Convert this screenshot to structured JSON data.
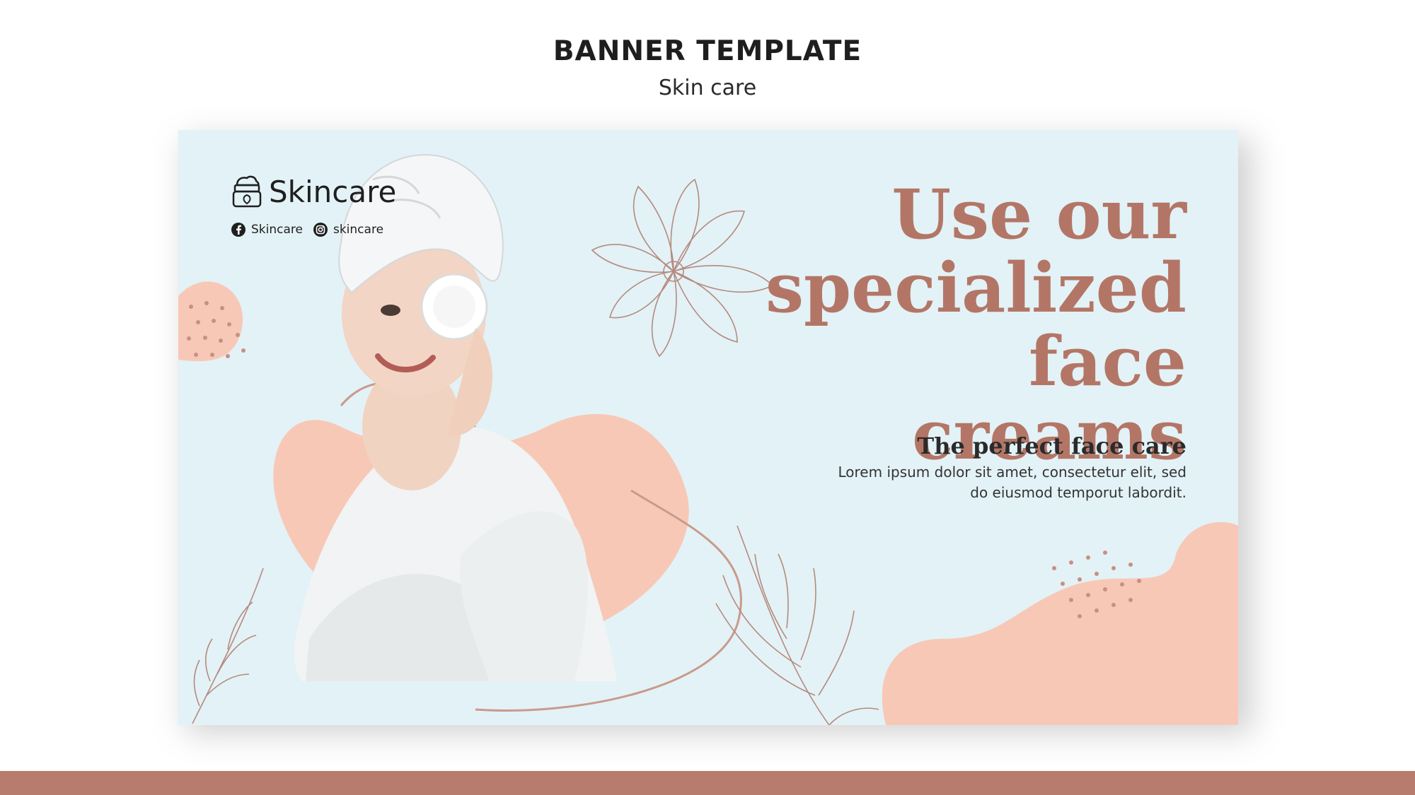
{
  "page": {
    "title": "BANNER TEMPLATE",
    "subtitle": "Skin care"
  },
  "banner": {
    "brand": "Skincare",
    "socials": [
      {
        "icon": "facebook-icon",
        "label": "Skincare"
      },
      {
        "icon": "instagram-icon",
        "label": "skincare"
      }
    ],
    "headline": "Use our specialized face creams",
    "tagline": "The perfect face care",
    "body": "Lorem ipsum dolor sit amet, consectetur elit, sed do eiusmod temporut labordit."
  },
  "colors": {
    "banner_background": "#e3f2f6",
    "accent_peach": "#f8c8b7",
    "headline": "#b37666",
    "line_art": "#b58a7f",
    "bottom_bar": "#b77c6d"
  }
}
